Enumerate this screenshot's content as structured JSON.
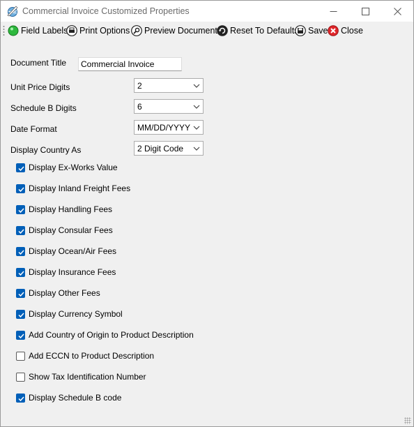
{
  "window": {
    "title": "Commercial Invoice Customized Properties"
  },
  "toolbar": {
    "items": [
      {
        "label": "Field Labels"
      },
      {
        "label": "Print Options"
      },
      {
        "label": "Preview Document"
      },
      {
        "label": "Reset To Defaults"
      },
      {
        "label": "Save"
      },
      {
        "label": "Close"
      }
    ]
  },
  "form": {
    "document_title": {
      "label": "Document Title",
      "value": "Commercial Invoice"
    },
    "unit_price_digits": {
      "label": "Unit Price Digits",
      "value": "2"
    },
    "schedule_b_digits": {
      "label": "Schedule B Digits",
      "value": "6"
    },
    "date_format": {
      "label": "Date Format",
      "value": "MM/DD/YYYY"
    },
    "display_country_as": {
      "label": "Display Country As",
      "value": "2 Digit Code"
    }
  },
  "options": [
    {
      "label": "Display Ex-Works Value",
      "checked": true
    },
    {
      "label": "Display Inland Freight Fees",
      "checked": true
    },
    {
      "label": "Display Handling Fees",
      "checked": true
    },
    {
      "label": "Display Consular Fees",
      "checked": true
    },
    {
      "label": "Display Ocean/Air Fees",
      "checked": true
    },
    {
      "label": "Display Insurance Fees",
      "checked": true
    },
    {
      "label": "Display Other Fees",
      "checked": true
    },
    {
      "label": "Display Currency Symbol",
      "checked": true
    },
    {
      "label": "Add Country of Origin to Product Description",
      "checked": true
    },
    {
      "label": "Add ECCN to Product Description",
      "checked": false
    },
    {
      "label": "Show Tax Identification Number",
      "checked": false
    },
    {
      "label": "Display Schedule B code",
      "checked": true
    }
  ],
  "colors": {
    "checkbox_accent": "#005fb8"
  }
}
